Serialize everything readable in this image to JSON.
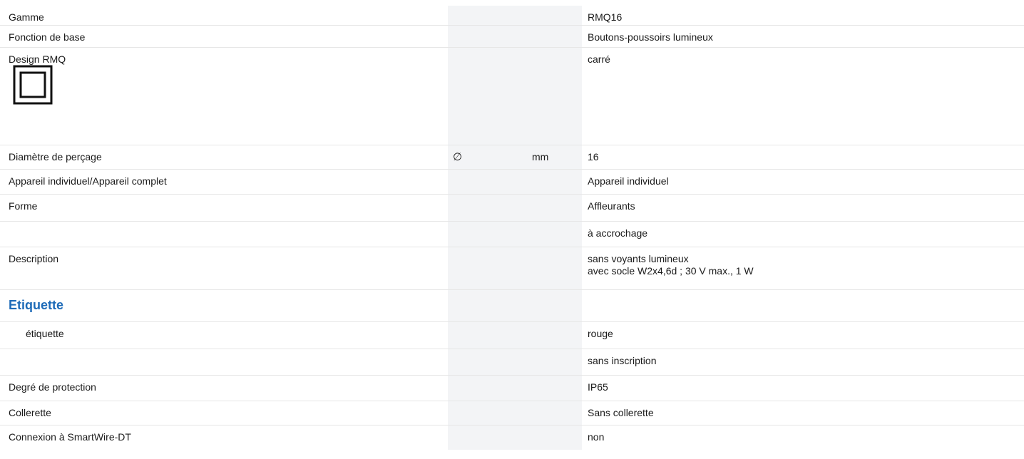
{
  "rows": [
    {
      "label": "Gamme",
      "value": "RMQ16"
    },
    {
      "label": "Fonction de base",
      "value": "Boutons-poussoirs lumineux"
    },
    {
      "label": "Design RMQ",
      "value": "carré"
    },
    {
      "label": "Diamètre de perçage",
      "symbol": "∅",
      "unit": "mm",
      "value": "16"
    },
    {
      "label": "Appareil individuel/Appareil complet",
      "value": "Appareil individuel"
    },
    {
      "label": "Forme",
      "value": "Affleurants"
    },
    {
      "label": "",
      "value": "à accrochage"
    },
    {
      "label": "Description",
      "value_line1": "sans voyants lumineux",
      "value_line2": "avec socle W2x4,6d ; 30 V max., 1 W"
    }
  ],
  "section": {
    "title": "Etiquette"
  },
  "section_rows": [
    {
      "label": "étiquette",
      "value": "rouge"
    },
    {
      "label": "",
      "value": "sans inscription"
    },
    {
      "label": "Degré de protection",
      "value": "IP65"
    },
    {
      "label": "Collerette",
      "value": "Sans collerette"
    },
    {
      "label": "Connexion à SmartWire-DT",
      "value": "non"
    }
  ],
  "icons": {
    "design": "square-design-icon"
  }
}
